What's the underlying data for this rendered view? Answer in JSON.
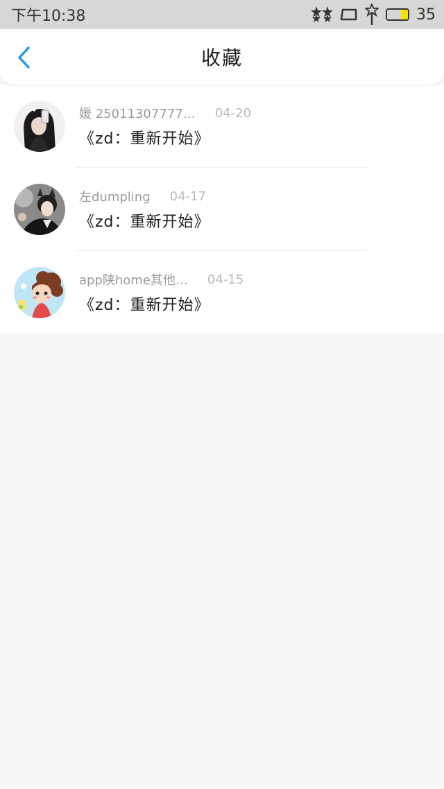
{
  "status_bar": {
    "time": "下午10:38",
    "battery_level": "35",
    "battery_fraction": 0.35,
    "icons": [
      "stars-icon",
      "screen-icon",
      "antenna-icon",
      "battery-icon"
    ]
  },
  "header": {
    "title": "收藏",
    "back_icon": "chevron-left-icon",
    "accent_color": "#2f9be6"
  },
  "favorites": [
    {
      "name": "媛 25011307777…",
      "date": "04-20",
      "message": "《zd：重新开始》"
    },
    {
      "name": "左dumpling",
      "date": "04-17",
      "message": "《zd：重新开始》"
    },
    {
      "name": "app陕home其他…",
      "date": "04-15",
      "message": "《zd：重新开始》"
    }
  ]
}
